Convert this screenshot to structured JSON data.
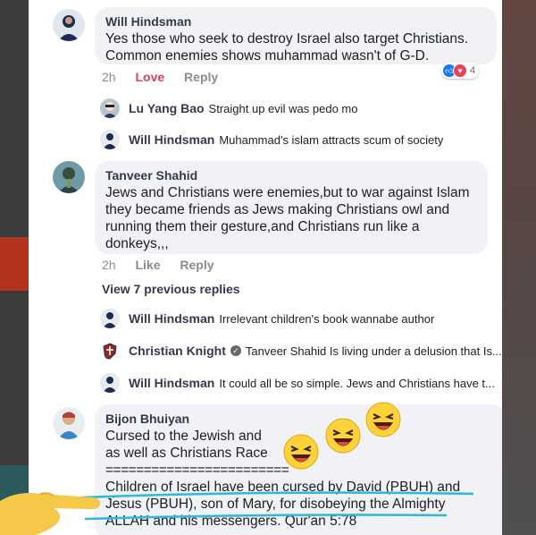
{
  "comments": [
    {
      "author": "Will Hindsman",
      "text": "Yes those who seek to destroy Israel also target Christians.\nCommon enemies shows muhammad wasn't of G-D.",
      "time": "2h",
      "love_label": "Love",
      "reply_label": "Reply",
      "reaction_count": "4",
      "replies": [
        {
          "author": "Lu Yang Bao",
          "text": "Straight up evil was pedo mo"
        },
        {
          "author": "Will Hindsman",
          "text": "Muhammad's islam attracts scum of society"
        }
      ]
    },
    {
      "author": "Tanveer Shahid",
      "text": "Jews and Christians were enemies,but to war against Islam\nthey became friends as Jews making Christians owl and\nrunning them their gesture,and Christians run like a\ndonkeys,,,",
      "time": "2h",
      "like_label": "Like",
      "reply_label": "Reply",
      "view_previous": "View 7 previous replies",
      "replies": [
        {
          "author": "Will Hindsman",
          "text": "Irrelevant children's book wannabe author"
        },
        {
          "author": "Christian Knight",
          "text": "Tanveer Shahid Is living under a delusion that Is..."
        },
        {
          "author": "Will Hindsman",
          "text": "It could all be so simple. Jews and Christians have t..."
        }
      ]
    },
    {
      "author": "Bijon Bhuiyan",
      "line1": "Cursed  to  the  Jewish and",
      "line2": " as well as  Christians   Race",
      "separator": "========================",
      "line3": "Children of Israel have been cursed by David (PBUH) and",
      "line4": "Jesus (PBUH), son of Mary, for disobeying the Almighty",
      "line5": "ALLAH and his messengers. Qur'an 5:78"
    }
  ],
  "colors": {
    "love": "#e4405f",
    "like_reaction": "#1877f2",
    "love_reaction": "#f33e58",
    "underline": "#2fb7e0",
    "hand": "#f5c84a"
  },
  "icons": [
    "laughing-emoji-icon",
    "like-reaction-icon",
    "love-reaction-icon",
    "verified-badge-icon",
    "pointing-hand-icon"
  ]
}
